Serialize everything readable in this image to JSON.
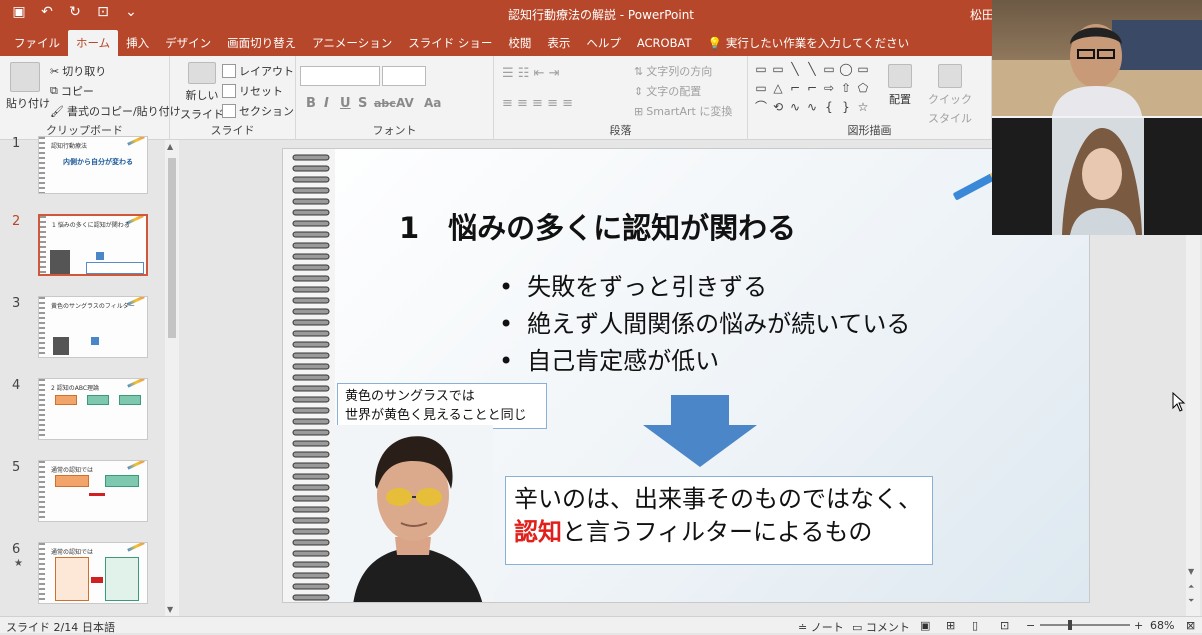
{
  "window": {
    "title": "認知行動療法の解説 - PowerPoint",
    "user": "松田"
  },
  "tabs": [
    {
      "label": "ファイル"
    },
    {
      "label": "ホーム"
    },
    {
      "label": "挿入"
    },
    {
      "label": "デザイン"
    },
    {
      "label": "画面切り替え"
    },
    {
      "label": "アニメーション"
    },
    {
      "label": "スライド ショー"
    },
    {
      "label": "校閲"
    },
    {
      "label": "表示"
    },
    {
      "label": "ヘルプ"
    },
    {
      "label": "ACROBAT"
    },
    {
      "label": "実行したい作業を入力してください"
    }
  ],
  "ribbon": {
    "clipboard": {
      "paste": "貼り付け",
      "cut": "切り取り",
      "copy": "コピー",
      "format_painter": "書式のコピー/貼り付け",
      "group": "クリップボード"
    },
    "slides": {
      "new_slide_1": "新しい",
      "new_slide_2": "スライド",
      "layout": "レイアウト",
      "reset": "リセット",
      "section": "セクション",
      "group": "スライド"
    },
    "font": {
      "bold": "B",
      "italic": "I",
      "underline": "U",
      "shadow": "S",
      "strike": "abc",
      "spacing": "AV",
      "case": "Aa",
      "group": "フォント"
    },
    "paragraph": {
      "text_direction": "文字列の方向",
      "align_text": "文字の配置",
      "smartart": "SmartArt に変換",
      "group": "段落"
    },
    "drawing": {
      "arrange": "配置",
      "quick_styles_1": "クイック",
      "quick_styles_2": "スタイル",
      "group": "図形描画"
    }
  },
  "thumbnails": [
    {
      "num": "1",
      "title": "認知行動療法",
      "sub": "内側から自分が変わる",
      "star": ""
    },
    {
      "num": "2",
      "title": "1 悩みの多くに認知が関わる",
      "sub": "",
      "star": ""
    },
    {
      "num": "3",
      "title": "黄色のサングラスのフィルター",
      "sub": "",
      "star": ""
    },
    {
      "num": "4",
      "title": "2 認知のABC理論",
      "sub": "",
      "star": ""
    },
    {
      "num": "5",
      "title": "通常の認知では",
      "sub": "",
      "star": ""
    },
    {
      "num": "6",
      "title": "通常の認知では",
      "sub": "",
      "star": "★"
    }
  ],
  "slide": {
    "title": "1　悩みの多くに認知が関わる",
    "bullets": [
      "失敗をずっと引きずる",
      "絶えず人間関係の悩みが続いている",
      "自己肯定感が低い"
    ],
    "callout_line1": "黄色のサングラスでは",
    "callout_line2": "世界が黄色く見えることと同じ",
    "msg_line1": "辛いのは、出来事そのものではなく、",
    "msg_red": "認知",
    "msg_line2_rest": "と言うフィルターによるもの"
  },
  "status": {
    "slide_counter": "スライド 2/14",
    "language": "日本語",
    "notes": "ノート",
    "comments": "コメント",
    "zoom": "68%"
  },
  "colors": {
    "accent": "#b7472a",
    "highlight_red": "#e0201b",
    "arrow_blue": "#4a86c8"
  }
}
